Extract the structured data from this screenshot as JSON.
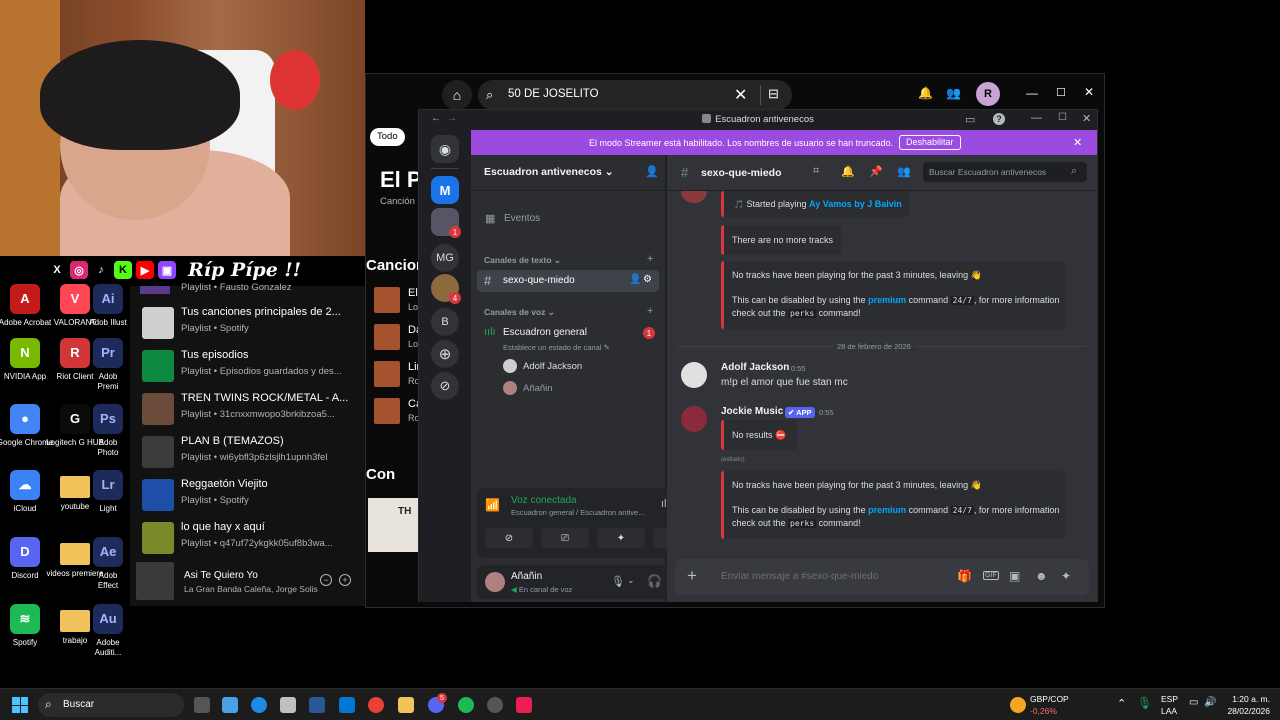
{
  "overlay": {
    "streamer_handle": "Ríp Pípe !!",
    "socials": [
      "X",
      "Instagram",
      "TikTok",
      "Kick",
      "YouTube",
      "Twitch"
    ]
  },
  "desktop": {
    "icons": [
      {
        "label": "Adobe Acrobat",
        "color": "#c31a1a",
        "glyph": "A"
      },
      {
        "label": "VALORANT",
        "color": "#ff4655",
        "glyph": "V"
      },
      {
        "label": "NVIDIA App",
        "color": "#76b900",
        "glyph": "N"
      },
      {
        "label": "Riot Client",
        "color": "#d13639",
        "glyph": "R"
      },
      {
        "label": "Google Chrome",
        "color": "#4285f4",
        "glyph": "●"
      },
      {
        "label": "Logitech G HUB",
        "color": "#0b0b0b",
        "glyph": "G"
      },
      {
        "label": "iCloud",
        "color": "#3b82f6",
        "glyph": "☁"
      },
      {
        "label": "youtube",
        "color": "#f1c35a",
        "glyph": ""
      },
      {
        "label": "Discord",
        "color": "#5865f2",
        "glyph": "D"
      },
      {
        "label": "videos premiere",
        "color": "#f1c35a",
        "glyph": ""
      },
      {
        "label": "Spotify",
        "color": "#1db954",
        "glyph": "≋"
      },
      {
        "label": "trabajo",
        "color": "#f1c35a",
        "glyph": ""
      }
    ],
    "partial_labels": [
      "Adob Illust",
      "Adob Premi",
      "Adob Photo",
      "Light",
      "Adob Effect",
      "Adobe Auditi..."
    ],
    "partial_glyphs": [
      "Ai",
      "Pr",
      "Ps",
      "Lr",
      "Ae",
      "Au"
    ]
  },
  "spotify_library": {
    "top_partial": "Playlist • Fausto Gonzalez",
    "items": [
      {
        "title": "Tus canciones principales de 2...",
        "sub": "Playlist • Spotify",
        "color": "#cfcfcf"
      },
      {
        "title": "Tus episodios",
        "sub": "Playlist • Episodios guardados y des...",
        "color": "#0d8a3f"
      },
      {
        "title": "TREN TWINS ROCK/METAL - A...",
        "sub": "Playlist • 31cnxxmwopo3brkibzoa5...",
        "color": "#6b4b3a"
      },
      {
        "title": "PLAN B (TEMAZOS)",
        "sub": "Playlist • wi6ybfl3p6zlsjlh1upnh3fel",
        "color": "#3b3b3b"
      },
      {
        "title": "Reggaetón Viejito",
        "sub": "Playlist • Spotify",
        "color": "#1e4fa8"
      },
      {
        "title": "lo que hay x aquí",
        "sub": "Playlist • q47uf72ykgkk05uf8b3wa...",
        "color": "#7a8a2b"
      }
    ],
    "now_playing": {
      "title": "Asi Te Quiero Yo",
      "artist": "La Gran Banda Caleña, Jorge Solis"
    }
  },
  "spotify_main": {
    "search_value": "50 DE JOSELITO",
    "filter_chip": "Todo",
    "title_partial": "El Pa",
    "sub_partial": "Canción",
    "section_partial": "Cancion",
    "section2_partial": "Con",
    "tracks_partial": [
      {
        "t": "El",
        "s": "Lo"
      },
      {
        "t": "Da",
        "s": "Lo"
      },
      {
        "t": "Lin",
        "s": "Ro"
      },
      {
        "t": "Ca",
        "s": "Ro"
      }
    ],
    "user_initial": "R",
    "card_partial": "TH"
  },
  "discord": {
    "window_title": "Escuadron antivenecos",
    "banner": {
      "text": "El modo Streamer está habilitado. Los nombres de usuario se han truncado.",
      "button": "Deshabilitar"
    },
    "guilds": [
      "MG",
      "B"
    ],
    "guild_badges": [
      "1",
      "4"
    ],
    "server_name": "Escuadron antivenecos",
    "events_label": "Eventos",
    "text_section": "Canales de texto",
    "text_channel": "sexo-que-miedo",
    "voice_section": "Canales de voz",
    "voice_channel": "Escuadron general",
    "voice_badge": "1",
    "voice_status_hint": "Establece un estado de canal",
    "voice_members": [
      "Adolf Jackson",
      "Añañin"
    ],
    "voice_panel": {
      "status": "Voz conectada",
      "location": "Escuadron general / Escuadron antive..."
    },
    "user_panel": {
      "name": "Añañin",
      "status": "En canal de voz"
    },
    "chat_channel": "sexo-que-miedo",
    "search_placeholder": "Buscar Escuadron antivenecos",
    "messages": {
      "card1_prefix": "Started playing ",
      "card1_link": "Ay Vamos by J Balvin",
      "card2": "There are no more tracks",
      "card3_line1": "No tracks have been playing for the past 3 minutes, leaving 👋",
      "card3_a": "This can be disabled by using the ",
      "card3_link": "premium",
      "card3_b": " command ",
      "card3_code": "24/7",
      "card3_c": ", for more information",
      "card3_d": "check out the ",
      "card3_code2": "perks",
      "card3_e": " command!",
      "date_divider": "28 de febrero de 2026",
      "author1": "Adolf Jackson",
      "time1": "0:55",
      "text1": "m!p el amor que fue stan mc",
      "author2": "Jockie Music",
      "app_tag": "✔ APP",
      "time2": "0:55",
      "card4": "No results ⛔",
      "edited": "(editado)"
    },
    "composer_placeholder": "Enviar mensaje a #sexo-que-miedo"
  },
  "taskbar": {
    "search": "Buscar",
    "currency": "GBP/COP",
    "currency_change": "-0,26%",
    "lang": "ESP",
    "region": "LAA",
    "time": "1:20 a. m.",
    "date": "28/02/2026",
    "notif_badge": "5"
  }
}
